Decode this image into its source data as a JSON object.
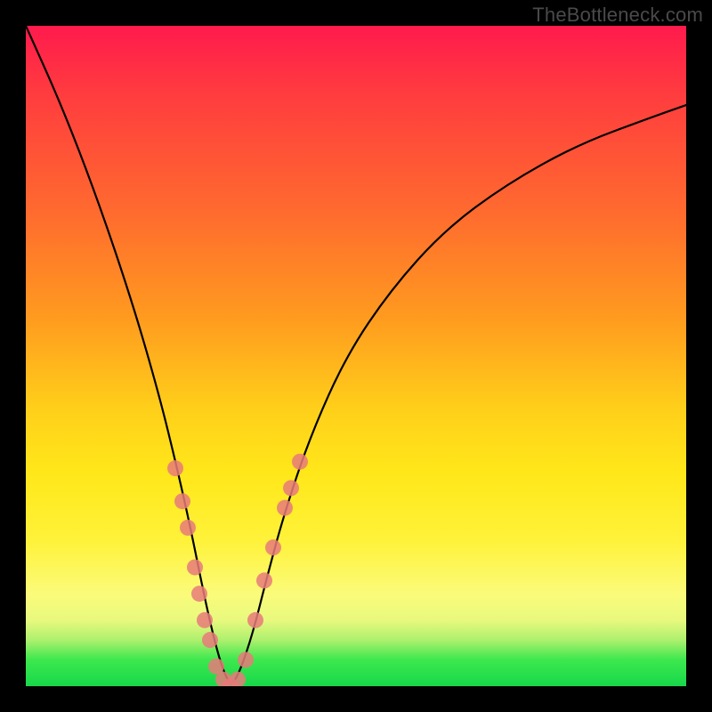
{
  "watermark": "TheBottleneck.com",
  "chart_data": {
    "type": "line",
    "title": "",
    "xlabel": "",
    "ylabel": "",
    "xlim": [
      0,
      742
    ],
    "ylim_percent": [
      0,
      100
    ],
    "gradient_note": "Vertical color gradient encodes bottleneck severity: red near top (~100%) to green at bottom (~0%).",
    "series": [
      {
        "name": "bottleneck-curve",
        "note": "V-shaped curve; y is estimated bottleneck percentage (0 at valley, 100 at top of plot). x is pixel position within 742px plot area.",
        "x": [
          0,
          40,
          80,
          120,
          150,
          170,
          185,
          200,
          210,
          220,
          230,
          240,
          255,
          270,
          290,
          320,
          360,
          410,
          470,
          540,
          620,
          700,
          742
        ],
        "y_percent": [
          100,
          88,
          74,
          58,
          44,
          33,
          24,
          14,
          8,
          3,
          0,
          2,
          8,
          16,
          26,
          38,
          50,
          60,
          69,
          76,
          82,
          86,
          88
        ]
      }
    ],
    "markers": {
      "name": "highlighted-points",
      "color": "#e77a7a",
      "radius_px": 9,
      "note": "Salmon circular markers clustered on both arms of the valley, lower ~30% of plot.",
      "points_xy_percent": [
        [
          168,
          33
        ],
        [
          176,
          28
        ],
        [
          182,
          24
        ],
        [
          190,
          18
        ],
        [
          195,
          14
        ],
        [
          201,
          10
        ],
        [
          207,
          7
        ],
        [
          214,
          3
        ],
        [
          222,
          1
        ],
        [
          230,
          0
        ],
        [
          238,
          1
        ],
        [
          247,
          4
        ],
        [
          258,
          10
        ],
        [
          268,
          16
        ],
        [
          278,
          21
        ],
        [
          291,
          27
        ],
        [
          298,
          30
        ],
        [
          308,
          34
        ]
      ]
    }
  }
}
